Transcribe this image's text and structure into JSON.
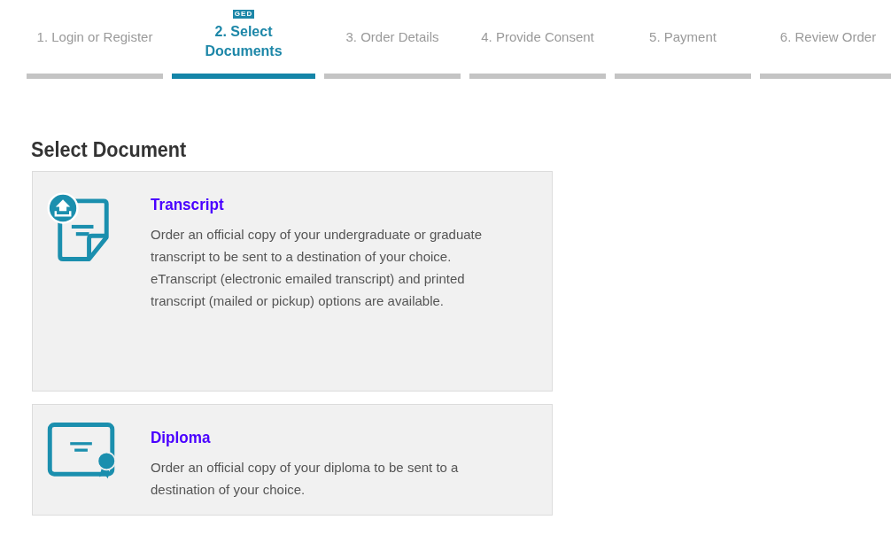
{
  "steps": [
    {
      "label": "1. Login or Register",
      "selected": false
    },
    {
      "label": "2. Select Documents",
      "selected": true,
      "logo": "GED"
    },
    {
      "label": "3. Order Details",
      "selected": false
    },
    {
      "label": "4. Provide Consent",
      "selected": false
    },
    {
      "label": "5. Payment",
      "selected": false
    },
    {
      "label": "6. Review Order",
      "selected": false
    }
  ],
  "heading": "Select Document",
  "documents": [
    {
      "kind": "transcript",
      "title": "Transcript",
      "description": "Order an official copy of your undergraduate or graduate transcript to be sent to a destination of your choice.  eTranscript (electronic emailed transcript) and printed transcript (mailed or pickup) options are available."
    },
    {
      "kind": "diploma",
      "title": "Diploma",
      "description": "Order an official copy of your diploma to be sent to a destination of your choice."
    }
  ]
}
